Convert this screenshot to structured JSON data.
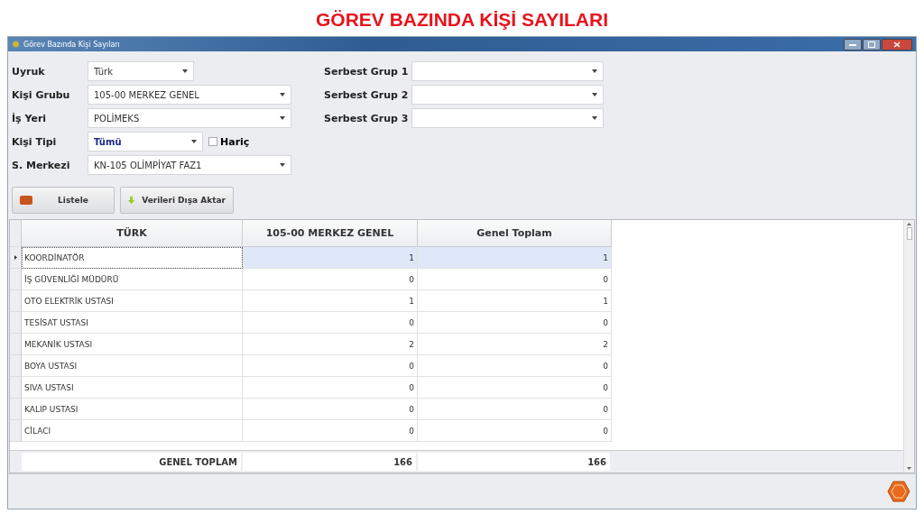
{
  "page_title": "GÖREV BAZINDA KİŞİ SAYILARI",
  "window": {
    "title": "Görev Bazında Kişi Sayıları"
  },
  "filters_left": [
    {
      "label": "Uyruk",
      "value": "Türk",
      "kind": "short"
    },
    {
      "label": "Kişi Grubu",
      "value": "105-00 MERKEZ GENEL",
      "kind": "wide"
    },
    {
      "label": "İş Yeri",
      "value": "POLİMEKS",
      "kind": "wide"
    },
    {
      "label": "Kişi Tipi",
      "value": "Tümü",
      "kind": "type"
    },
    {
      "label": "S. Merkezi",
      "value": "KN-105 OLİMPİYAT FAZ1",
      "kind": "wide"
    }
  ],
  "exclude_checkbox": {
    "label": "Hariç",
    "checked": false
  },
  "filters_right": [
    {
      "label": "Serbest Grup 1"
    },
    {
      "label": "Serbest Grup 2"
    },
    {
      "label": "Serbest Grup 3"
    }
  ],
  "buttons": [
    {
      "label": "Listele",
      "kind": "list"
    },
    {
      "label": "Verileri Dışa Aktar",
      "kind": "export"
    }
  ],
  "table": {
    "columns": [
      "TÜRK",
      "105-00 MERKEZ GENEL",
      "Genel Toplam"
    ],
    "rows": [
      {
        "cells": [
          "KOORDİNATÖR",
          "1",
          "1"
        ],
        "selected": true
      },
      {
        "cells": [
          "İŞ GÜVENLİĞİ MÜDÜRÜ",
          "0",
          "0"
        ],
        "selected": false
      },
      {
        "cells": [
          "OTO ELEKTRİK USTASI",
          "1",
          "1"
        ],
        "selected": false
      },
      {
        "cells": [
          "TESİSAT USTASI",
          "0",
          "0"
        ],
        "selected": false
      },
      {
        "cells": [
          "MEKANİK USTASI",
          "2",
          "2"
        ],
        "selected": false
      },
      {
        "cells": [
          "BOYA USTASI",
          "0",
          "0"
        ],
        "selected": false
      },
      {
        "cells": [
          "SIVA USTASI",
          "0",
          "0"
        ],
        "selected": false
      },
      {
        "cells": [
          "KALIP USTASI",
          "0",
          "0"
        ],
        "selected": false
      },
      {
        "cells": [
          "CİLACI",
          "0",
          "0"
        ],
        "selected": false
      }
    ],
    "footer": [
      "GENEL TOPLAM",
      "166",
      "166"
    ]
  }
}
